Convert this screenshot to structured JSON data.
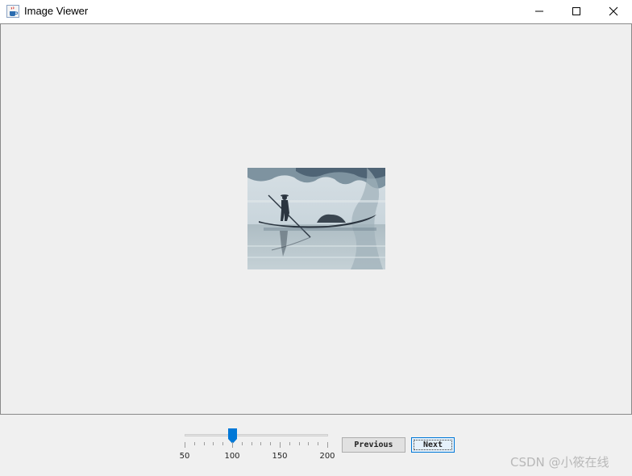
{
  "window": {
    "title": "Image Viewer",
    "icon": "java-coffee-cup-icon",
    "controls": [
      "minimize-icon",
      "maximize-icon",
      "close-icon"
    ]
  },
  "viewer": {
    "image": "ink painting of a boatman poling a small boat on misty water"
  },
  "zoom_slider": {
    "min": 50,
    "max": 200,
    "value": 100,
    "major_ticks": [
      "50",
      "100",
      "150",
      "200"
    ]
  },
  "buttons": {
    "previous_label": "Previous",
    "next_label": "Next"
  },
  "watermark": "CSDN @小筱在线",
  "colors": {
    "accent": "#0078d7",
    "background": "#f0f0f0",
    "titlebar": "#ffffff"
  }
}
